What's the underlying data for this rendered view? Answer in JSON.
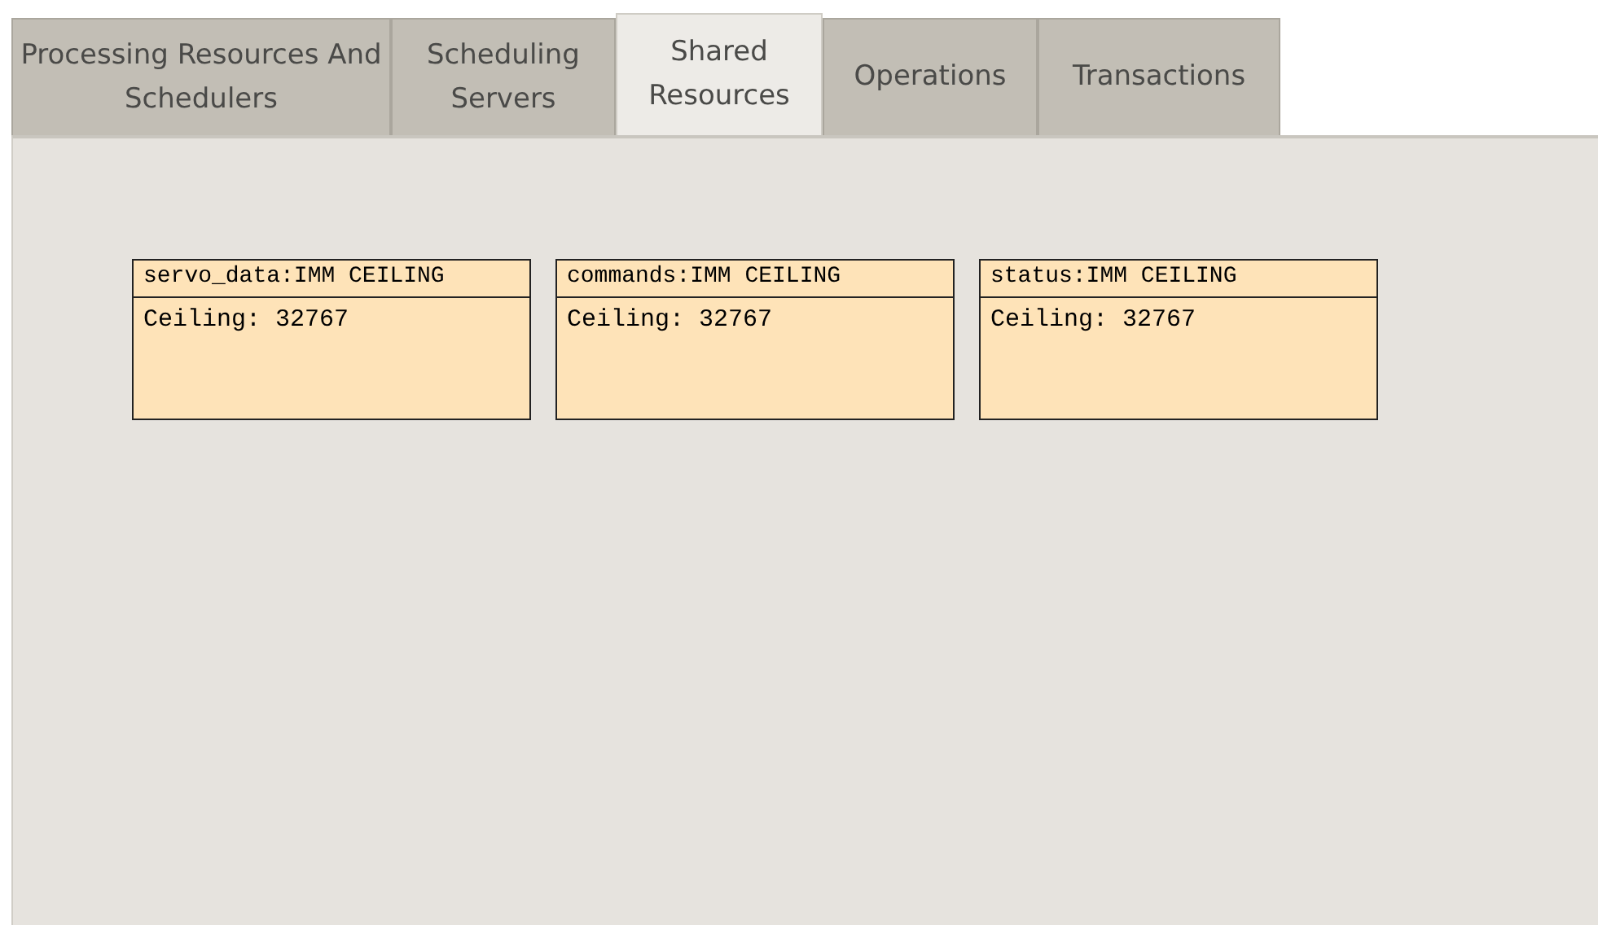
{
  "tabs": [
    {
      "label": "Processing Resources And Schedulers",
      "selected": false
    },
    {
      "label": "Scheduling Servers",
      "selected": false
    },
    {
      "label": "Shared Resources",
      "selected": true
    },
    {
      "label": "Operations",
      "selected": false
    },
    {
      "label": "Transactions",
      "selected": false
    }
  ],
  "resources": [
    {
      "title": "servo_data:IMM CEILING",
      "ceiling": "Ceiling: 32767"
    },
    {
      "title": "commands:IMM CEILING",
      "ceiling": "Ceiling: 32767"
    },
    {
      "title": "status:IMM CEILING",
      "ceiling": "Ceiling: 32767"
    }
  ]
}
